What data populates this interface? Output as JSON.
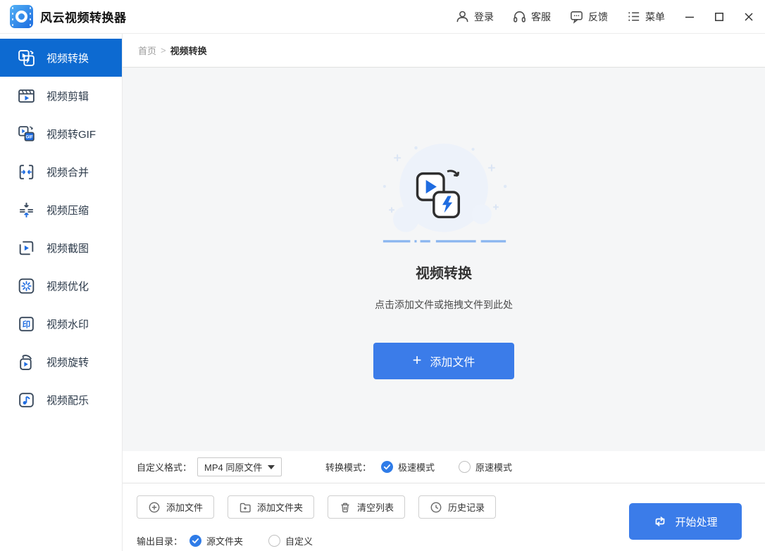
{
  "colors": {
    "primary": "#3b7ce9",
    "sidebar_active": "#0d6ad1",
    "icon_accent": "#1f6ce0",
    "icon_dark": "#37475a"
  },
  "titlebar": {
    "app_title": "风云视频转换器",
    "login": "登录",
    "support": "客服",
    "feedback": "反馈",
    "menu": "菜单"
  },
  "sidebar": {
    "items": [
      {
        "label": "视频转换",
        "active": true
      },
      {
        "label": "视频剪辑",
        "active": false
      },
      {
        "label": "视频转GIF",
        "active": false
      },
      {
        "label": "视频合并",
        "active": false
      },
      {
        "label": "视频压缩",
        "active": false
      },
      {
        "label": "视频截图",
        "active": false
      },
      {
        "label": "视频优化",
        "active": false
      },
      {
        "label": "视频水印",
        "active": false
      },
      {
        "label": "视频旋转",
        "active": false
      },
      {
        "label": "视频配乐",
        "active": false
      }
    ]
  },
  "breadcrumb": {
    "home": "首页",
    "separator": ">",
    "current": "视频转换"
  },
  "dropzone": {
    "title": "视频转换",
    "hint": "点击添加文件或拖拽文件到此处",
    "add_button_plus": "+",
    "add_button_label": "添加文件"
  },
  "settings": {
    "format_label": "自定义格式：",
    "format_value": "MP4 同原文件",
    "mode_label": "转换模式：",
    "fast_mode": "极速模式",
    "fast_mode_checked": true,
    "normal_mode": "原速模式",
    "normal_mode_checked": false
  },
  "toolbar": {
    "add_file": "添加文件",
    "add_folder": "添加文件夹",
    "clear_list": "清空列表",
    "history": "历史记录",
    "start": "开始处理"
  },
  "output": {
    "label": "输出目录：",
    "source_folder": "源文件夹",
    "source_folder_checked": true,
    "custom": "自定义",
    "custom_checked": false
  }
}
